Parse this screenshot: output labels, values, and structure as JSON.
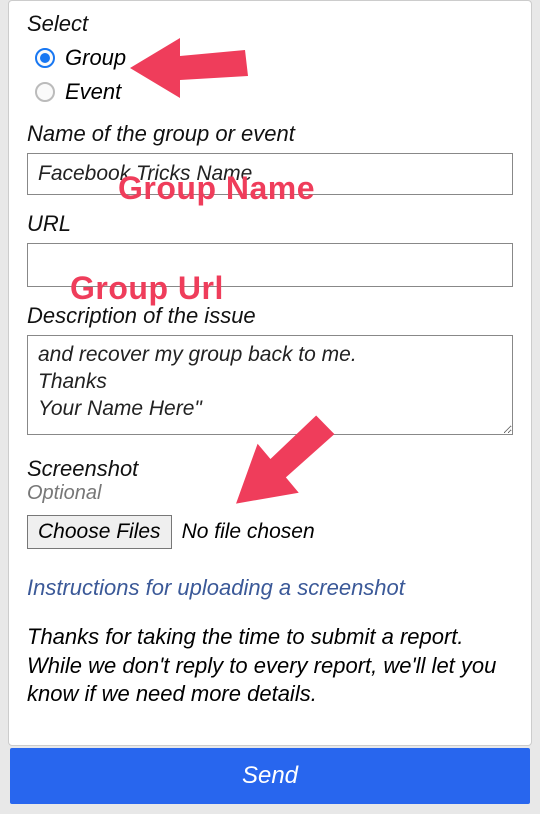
{
  "form": {
    "select_label": "Select",
    "radios": {
      "group": "Group",
      "event": "Event"
    },
    "name_label": "Name of the group or event",
    "name_value": "Facebook Tricks Name",
    "url_label": "URL",
    "url_value": "",
    "desc_label": "Description of the issue",
    "desc_value": "and recover my group back to me.\nThanks\nYour Name Here\"",
    "screenshot_label": "Screenshot",
    "optional": "Optional",
    "choose_files": "Choose Files",
    "no_file": "No file chosen",
    "instructions": "Instructions for uploading a screenshot",
    "thanks": "Thanks for taking the time to submit a report. While we don't reply to every report, we'll let you know if we need more details.",
    "send": "Send"
  },
  "annotations": {
    "group_name": "Group Name",
    "group_url": "Group Url"
  }
}
